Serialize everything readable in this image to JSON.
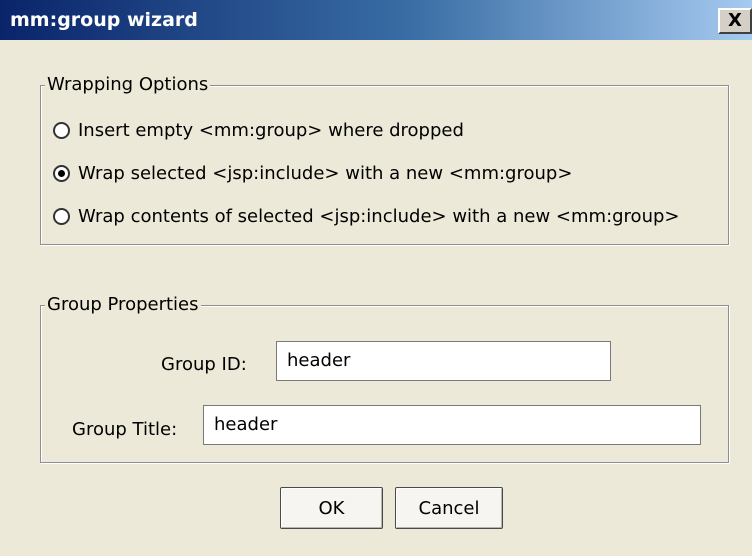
{
  "window": {
    "title": "mm:group wizard",
    "close_label": "X"
  },
  "wrapping_options": {
    "legend": "Wrapping Options",
    "options": [
      {
        "label": "Insert empty <mm:group> where dropped",
        "selected": false
      },
      {
        "label": "Wrap selected <jsp:include> with a new <mm:group>",
        "selected": true
      },
      {
        "label": "Wrap contents of selected <jsp:include> with a new <mm:group>",
        "selected": false
      }
    ]
  },
  "group_properties": {
    "legend": "Group Properties",
    "group_id": {
      "label": "Group ID:",
      "value": "header"
    },
    "group_title": {
      "label": "Group Title:",
      "value": "header"
    }
  },
  "buttons": {
    "ok": "OK",
    "cancel": "Cancel"
  }
}
